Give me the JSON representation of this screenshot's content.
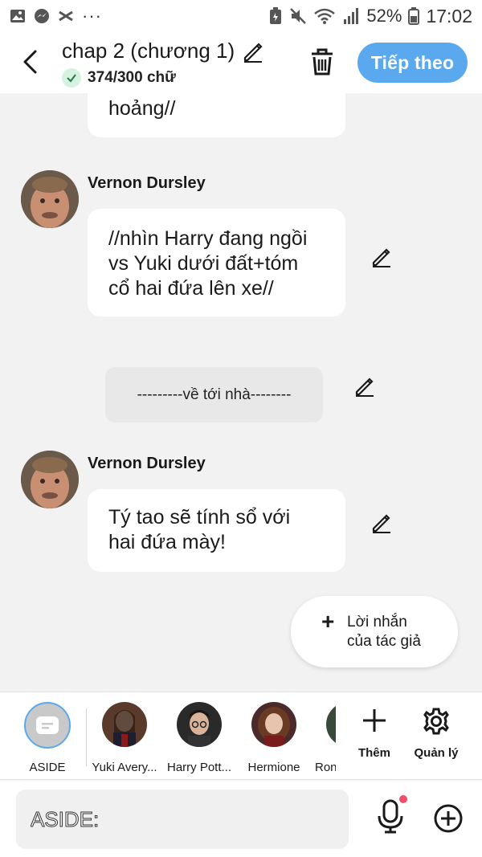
{
  "status_bar": {
    "battery_percent": "52%",
    "time": "17:02",
    "left_icons": [
      "gallery-icon",
      "messenger-icon",
      "capcut-icon",
      "more-dots-icon"
    ],
    "right_icons": [
      "battery-saver-icon",
      "mute-icon",
      "wifi-icon",
      "signal-icon",
      "battery-icon"
    ]
  },
  "header": {
    "title": "chap 2 (chương 1)",
    "word_count": "374/300 chữ",
    "next_label": "Tiếp theo",
    "accent_color": "#5aa9ef"
  },
  "messages": [
    {
      "type": "bubble_partial",
      "text": "hoảng//"
    },
    {
      "type": "dialogue",
      "speaker": "Vernon Dursley",
      "lines": [
        "//nhìn Harry đang ngồi",
        "vs Yuki dưới đất+tóm",
        "cổ hai đứa lên xe//"
      ]
    },
    {
      "type": "narration",
      "text": "---------về tới nhà--------"
    },
    {
      "type": "dialogue",
      "speaker": "Vernon Dursley",
      "lines": [
        "Tý tao sẽ tính sổ với",
        "hai đứa mày!"
      ]
    }
  ],
  "author_note": {
    "lines": [
      "Lời nhắn",
      "của tác giả"
    ]
  },
  "characters": [
    {
      "name": "ASIDE"
    },
    {
      "name": "Yuki Avery..."
    },
    {
      "name": "Harry Pott..."
    },
    {
      "name": "Hermione"
    },
    {
      "name": "Ron"
    }
  ],
  "tools": {
    "add_label": "Thêm",
    "manage_label": "Quản lý"
  },
  "input": {
    "placeholder": "ASIDE:"
  }
}
